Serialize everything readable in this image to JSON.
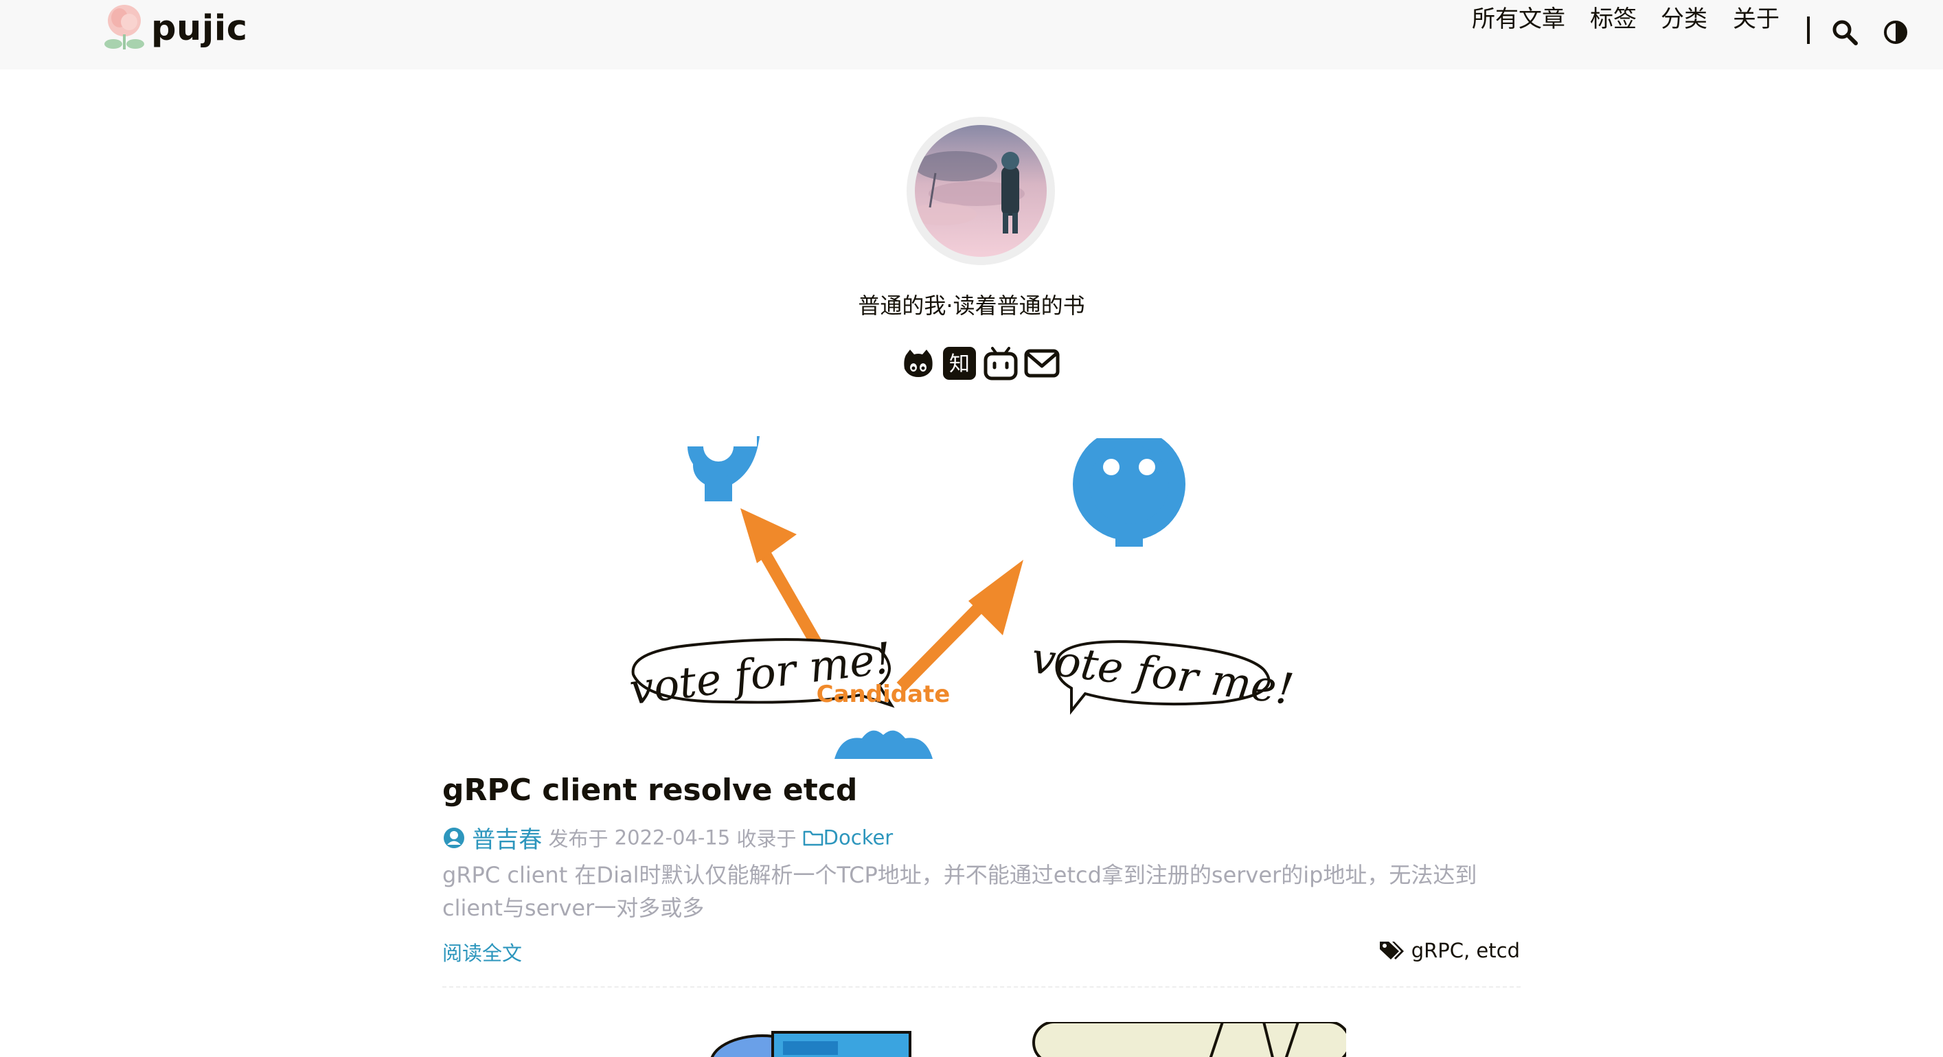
{
  "site": {
    "name": "pujic"
  },
  "nav": {
    "items": [
      "所有文章",
      "标签",
      "分类",
      "关于"
    ],
    "search_icon": "search-icon",
    "theme_icon": "theme-toggle-icon"
  },
  "profile": {
    "subtitle": "普通的我·读着普通的书",
    "social": [
      {
        "name": "github",
        "icon": "github-icon"
      },
      {
        "name": "zhihu",
        "icon": "zhihu-icon",
        "glyph": "知"
      },
      {
        "name": "bilibili",
        "icon": "bilibili-icon"
      },
      {
        "name": "email",
        "icon": "email-icon"
      }
    ]
  },
  "post": {
    "cover": {
      "left_bubble": "vote for me!",
      "center_label": "Candidate",
      "right_bubble": "vote for me!"
    },
    "title": "gRPC client resolve etcd",
    "author": "普吉春",
    "published_prefix": "发布于",
    "date": "2022-04-15",
    "category_prefix": "收录于",
    "category": "Docker",
    "summary": "gRPC client 在Dial时默认仅能解析一个TCP地址，并不能通过etcd拿到注册的server的ip地址，无法达到client与server一对多或多",
    "read_more": "阅读全文",
    "tags": [
      "gRPC",
      "etcd"
    ],
    "tags_separator": ", "
  },
  "colors": {
    "accent": "#2d96bd",
    "muted": "#a9a9b3",
    "text": "#161209",
    "header_bg": "#f8f8f8",
    "raft_blue": "#3c9bdc",
    "raft_orange": "#f0892a"
  }
}
